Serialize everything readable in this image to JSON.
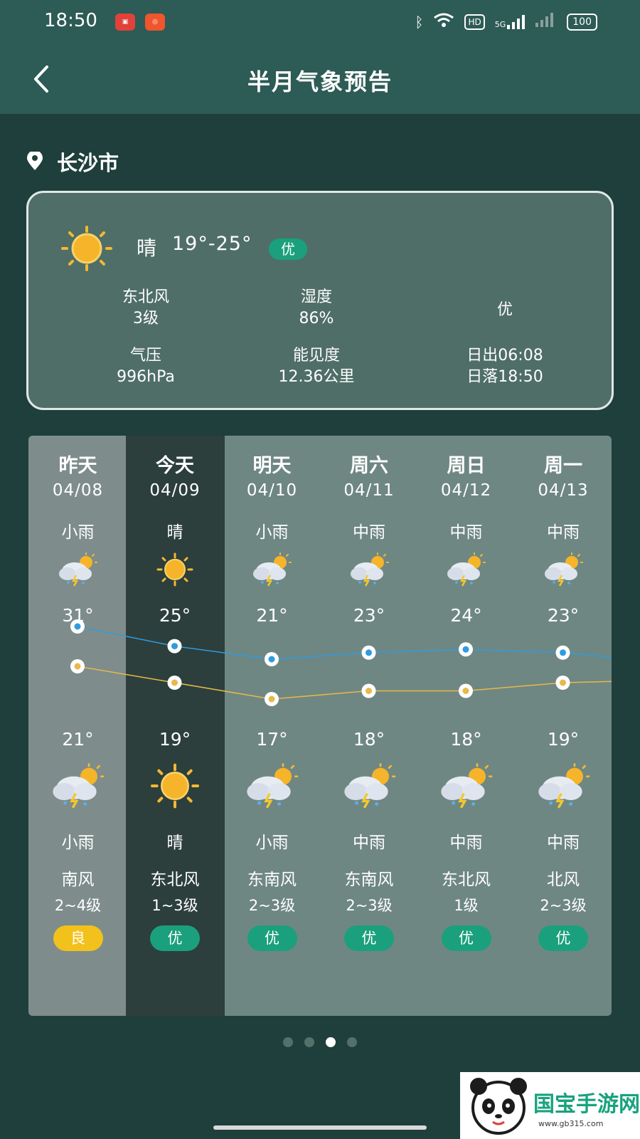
{
  "status_bar": {
    "time": "18:50",
    "network": "5G",
    "hd_label": "HD",
    "battery": "100",
    "icons": [
      "app-store-icon",
      "kuaishou-icon",
      "bluetooth-icon",
      "wifi-icon",
      "hd-icon",
      "signal-5g-icon",
      "signal-icon",
      "battery-icon"
    ]
  },
  "header": {
    "title": "半月气象预告",
    "back_icon": "chevron-left-icon"
  },
  "location": {
    "city": "长沙市",
    "icon": "location-pin-icon"
  },
  "today_card": {
    "icon": "sun-icon",
    "condition": "晴",
    "temp_range": "19°-25°",
    "air_quality": "优",
    "wind_direction": "东北风",
    "wind_level": "3级",
    "humidity_label": "湿度",
    "humidity": "86%",
    "aqi_text": "优",
    "pressure_label": "气压",
    "pressure": "996hPa",
    "visibility_label": "能见度",
    "visibility": "12.36公里",
    "sunrise": "日出06:08",
    "sunset": "日落18:50"
  },
  "forecast": {
    "colors": {
      "high_line": "#2f9be0",
      "low_line": "#e8b84a",
      "aq_good": "#1aa07c",
      "aq_fair": "#f3c11c"
    },
    "days": [
      {
        "weekday": "昨天",
        "date": "04/08",
        "day_cond": "小雨",
        "day_icon": "sun-cloud-rain-icon",
        "high": "31°",
        "high_value": 31,
        "low": "21°",
        "low_value": 21,
        "night_icon": "sun-cloud-rain-icon",
        "night_cond": "小雨",
        "wind_dir": "南风",
        "wind_level": "2~4级",
        "aq": "良",
        "aq_color": "#f3c11c"
      },
      {
        "weekday": "今天",
        "date": "04/09",
        "day_cond": "晴",
        "day_icon": "sun-icon",
        "high": "25°",
        "high_value": 25,
        "low": "19°",
        "low_value": 19,
        "night_icon": "sun-icon",
        "night_cond": "晴",
        "wind_dir": "东北风",
        "wind_level": "1~3级",
        "aq": "优",
        "aq_color": "#1aa07c"
      },
      {
        "weekday": "明天",
        "date": "04/10",
        "day_cond": "小雨",
        "day_icon": "sun-cloud-rain-icon",
        "high": "21°",
        "high_value": 21,
        "low": "17°",
        "low_value": 17,
        "night_icon": "sun-cloud-rain-icon",
        "night_cond": "小雨",
        "wind_dir": "东南风",
        "wind_level": "2~3级",
        "aq": "优",
        "aq_color": "#1aa07c"
      },
      {
        "weekday": "周六",
        "date": "04/11",
        "day_cond": "中雨",
        "day_icon": "sun-cloud-rain-icon",
        "high": "23°",
        "high_value": 23,
        "low": "18°",
        "low_value": 18,
        "night_icon": "sun-cloud-rain-icon",
        "night_cond": "中雨",
        "wind_dir": "东南风",
        "wind_level": "2~3级",
        "aq": "优",
        "aq_color": "#1aa07c"
      },
      {
        "weekday": "周日",
        "date": "04/12",
        "day_cond": "中雨",
        "day_icon": "sun-cloud-rain-icon",
        "high": "24°",
        "high_value": 24,
        "low": "18°",
        "low_value": 18,
        "night_icon": "sun-cloud-rain-icon",
        "night_cond": "中雨",
        "wind_dir": "东北风",
        "wind_level": "1级",
        "aq": "优",
        "aq_color": "#1aa07c"
      },
      {
        "weekday": "周一",
        "date": "04/13",
        "day_cond": "中雨",
        "day_icon": "sun-cloud-rain-icon",
        "high": "23°",
        "high_value": 23,
        "low": "19°",
        "low_value": 19,
        "night_icon": "sun-cloud-rain-icon",
        "night_cond": "中雨",
        "wind_dir": "北风",
        "wind_level": "2~3级",
        "aq": "优",
        "aq_color": "#1aa07c"
      }
    ]
  },
  "pager": {
    "count": 4,
    "active_index": 2
  },
  "watermark": {
    "text": "国宝手游网",
    "url": "www.gb315.com",
    "icon": "panda-logo-icon"
  }
}
